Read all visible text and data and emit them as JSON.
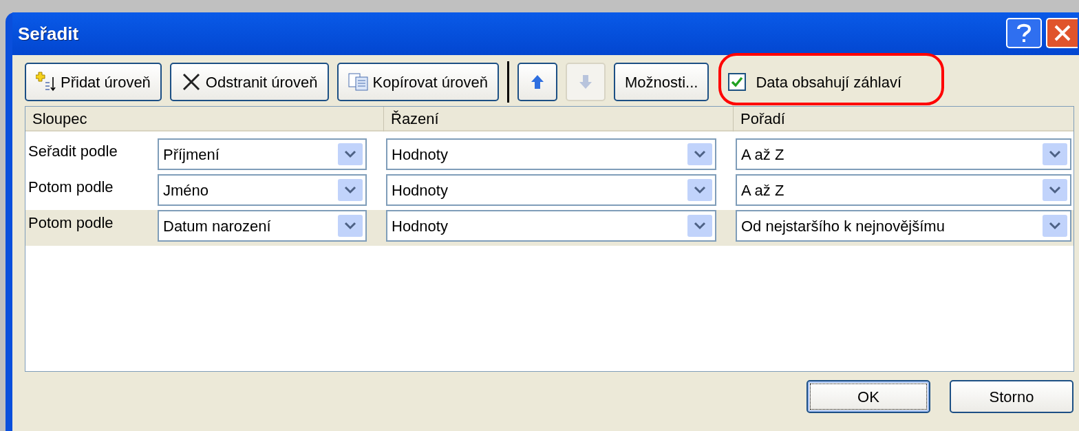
{
  "window": {
    "title": "Seřadit"
  },
  "toolbar": [
    {
      "kind": "add",
      "label": "Přidat úroveň",
      "disabled": false
    },
    {
      "kind": "delete",
      "label": "Odstranit úroveň",
      "disabled": false
    },
    {
      "kind": "copy",
      "label": "Kopírovat úroveň",
      "disabled": false
    },
    {
      "kind": "up",
      "disabled": false
    },
    {
      "kind": "down",
      "disabled": true
    },
    {
      "kind": "options",
      "label": "Možnosti...",
      "disabled": false
    }
  ],
  "header_checkbox": {
    "label": "Data obsahují záhlaví",
    "checked": true
  },
  "grid": {
    "columns": [
      "Sloupec",
      "Řazení",
      "Pořadí"
    ],
    "rows": [
      {
        "label": "Seřadit podle",
        "column": "Příjmení",
        "sort_on": "Hodnoty",
        "order": "A až Z",
        "selected": false
      },
      {
        "label": "Potom podle",
        "column": "Jméno",
        "sort_on": "Hodnoty",
        "order": "A až Z",
        "selected": false
      },
      {
        "label": "Potom podle",
        "column": "Datum narození",
        "sort_on": "Hodnoty",
        "order": "Od nejstaršího k nejnovějšímu",
        "selected": true
      }
    ]
  },
  "buttons": [
    {
      "label": "OK",
      "default": true
    },
    {
      "label": "Storno",
      "default": false
    }
  ]
}
